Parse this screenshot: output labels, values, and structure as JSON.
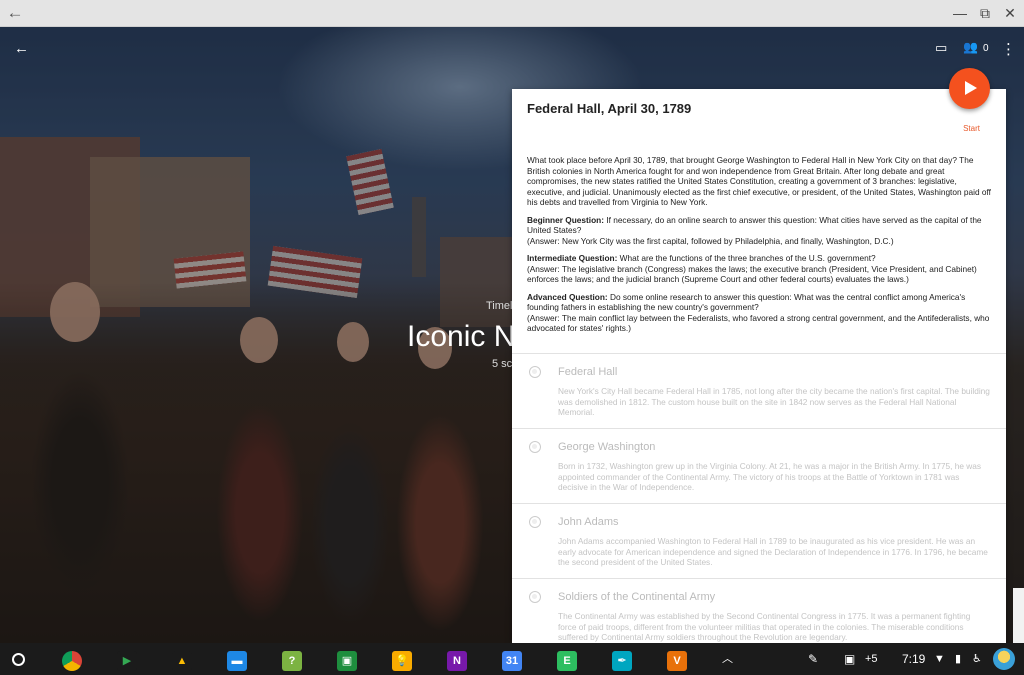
{
  "window": {
    "back_icon": "arrow-left-icon",
    "controls": [
      "minimize-icon",
      "restore-icon",
      "close-icon"
    ]
  },
  "hero": {
    "small_label": "Timel",
    "title": "Iconic N",
    "subtitle": "5 sc"
  },
  "toolbar": {
    "viewers_count": "0"
  },
  "panel": {
    "title": "Federal Hall, April 30, 1789",
    "start_label": "Start",
    "intro": "What took place before April 30, 1789, that brought George Washington to Federal Hall in New York City on that day? The British colonies in North America fought for and won independence from Great Britain. After long debate and great compromises, the new states ratified the United States Constitution, creating a government of 3 branches: legislative, executive, and judicial. Unanimously elected as the first chief executive, or president, of the United States, Washington paid off his debts and travelled from Virginia to New York.",
    "beginner_label": "Beginner Question:",
    "beginner_q": " If necessary, do an online search to answer this question: What cities have served as the capital of the United States?",
    "beginner_a": "(Answer: New York City was the first capital, followed by Philadelphia, and finally, Washington, D.C.)",
    "intermediate_label": "Intermediate Question:",
    "intermediate_q": " What are the functions of the three branches of the U.S. government?",
    "intermediate_a": "(Answer: The legislative branch (Congress) makes the laws; the executive branch (President, Vice President, and Cabinet) enforces the laws; and the judicial branch (Supreme Court and other federal courts) evaluates the laws.)",
    "advanced_label": "Advanced Question:",
    "advanced_q": " Do some online research to answer this question: What was the central conflict among America's founding fathers in establishing the new country's government?",
    "advanced_a": "(Answer: The main conflict lay between the Federalists, who favored a strong central government, and the Antifederalists, who advocated for states' rights.)",
    "items": [
      {
        "title": "Federal Hall",
        "text": "New York's City Hall became Federal Hall in 1785, not long after the city became the nation's first capital. The building was demolished in 1812. The custom house built on the site in 1842 now serves as the Federal Hall National Memorial."
      },
      {
        "title": "George Washington",
        "text": "Born in 1732, Washington grew up in the Virginia Colony. At 21, he was a major in the British Army. In 1775, he was appointed commander of the Continental Army. The victory of his troops at the Battle of Yorktown in 1781 was decisive in the War of Independence."
      },
      {
        "title": "John Adams",
        "text": "John Adams accompanied Washington to Federal Hall in 1789 to be inaugurated as his vice president. He was an early advocate for American independence and signed the Declaration of Independence in 1776. In 1796, he became the second president of the United States."
      },
      {
        "title": "Soldiers of the Continental Army",
        "text": "The Continental Army was established by the Second Continental Congress in 1775. It was a permanent fighting force of paid troops, different from the volunteer militias that operated in the colonies. The miserable conditions suffered by Continental Army soldiers throughout the Revolution are legendary."
      }
    ]
  },
  "shelf": {
    "apps": [
      {
        "name": "chrome",
        "glyph": "",
        "color": "#db4437"
      },
      {
        "name": "play-store",
        "glyph": "▶",
        "color": "#1b1b1b"
      },
      {
        "name": "drive",
        "glyph": "▲",
        "color": "#1b1b1b"
      },
      {
        "name": "files",
        "glyph": "▬",
        "color": "#1e88e5"
      },
      {
        "name": "quiz",
        "glyph": "?",
        "color": "#7cb342"
      },
      {
        "name": "classroom",
        "glyph": "▣",
        "color": "#1e8e3e"
      },
      {
        "name": "keep",
        "glyph": "💡",
        "color": "#f9ab00"
      },
      {
        "name": "onenote",
        "glyph": "N",
        "color": "#7719aa"
      },
      {
        "name": "calendar",
        "glyph": "31",
        "color": "#4285f4"
      },
      {
        "name": "evernote",
        "glyph": "E",
        "color": "#2dbe60"
      },
      {
        "name": "pen-app",
        "glyph": "✒",
        "color": "#00a6c0"
      },
      {
        "name": "vectr",
        "glyph": "V",
        "color": "#e8710a"
      }
    ],
    "notification_count": "+5",
    "time": "7:19"
  }
}
